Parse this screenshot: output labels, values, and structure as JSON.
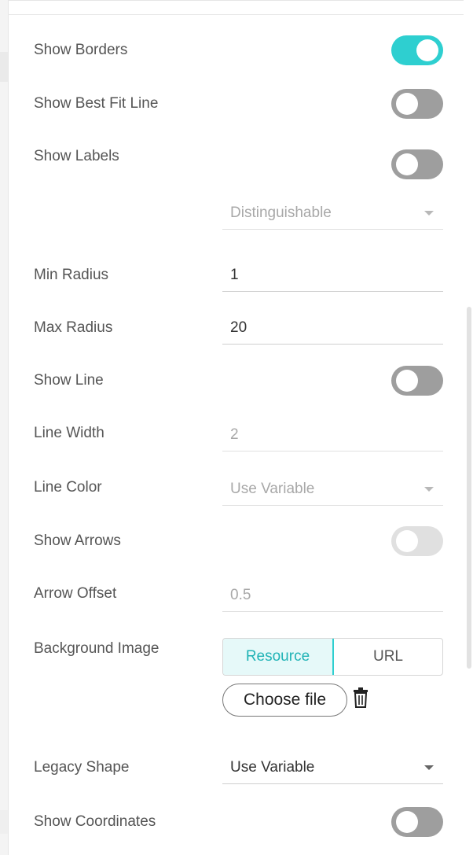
{
  "settings": {
    "show_borders": {
      "label": "Show Borders",
      "state": "on"
    },
    "show_best_fit_line": {
      "label": "Show Best Fit Line",
      "state": "off"
    },
    "show_labels": {
      "label": "Show Labels",
      "state": "off"
    },
    "label_mode": {
      "value": "Distinguishable"
    },
    "min_radius": {
      "label": "Min Radius",
      "value": "1"
    },
    "max_radius": {
      "label": "Max Radius",
      "value": "20"
    },
    "show_line": {
      "label": "Show Line",
      "state": "off"
    },
    "line_width": {
      "label": "Line Width",
      "value": "2"
    },
    "line_color": {
      "label": "Line Color",
      "value": "Use Variable"
    },
    "show_arrows": {
      "label": "Show Arrows",
      "state": "off"
    },
    "arrow_offset": {
      "label": "Arrow Offset",
      "value": "0.5"
    },
    "background_image": {
      "label": "Background Image",
      "options": [
        "Resource",
        "URL"
      ],
      "selected": "Resource",
      "choose_file_label": "Choose file"
    },
    "legacy_shape": {
      "label": "Legacy Shape",
      "value": "Use Variable"
    },
    "show_coordinates": {
      "label": "Show Coordinates",
      "state": "off"
    }
  },
  "colors": {
    "accent": "#2ecfd0",
    "toggle_off": "#9e9e9e"
  },
  "icons": {
    "dropdown": "chevron-down-icon",
    "delete": "trash-icon"
  }
}
